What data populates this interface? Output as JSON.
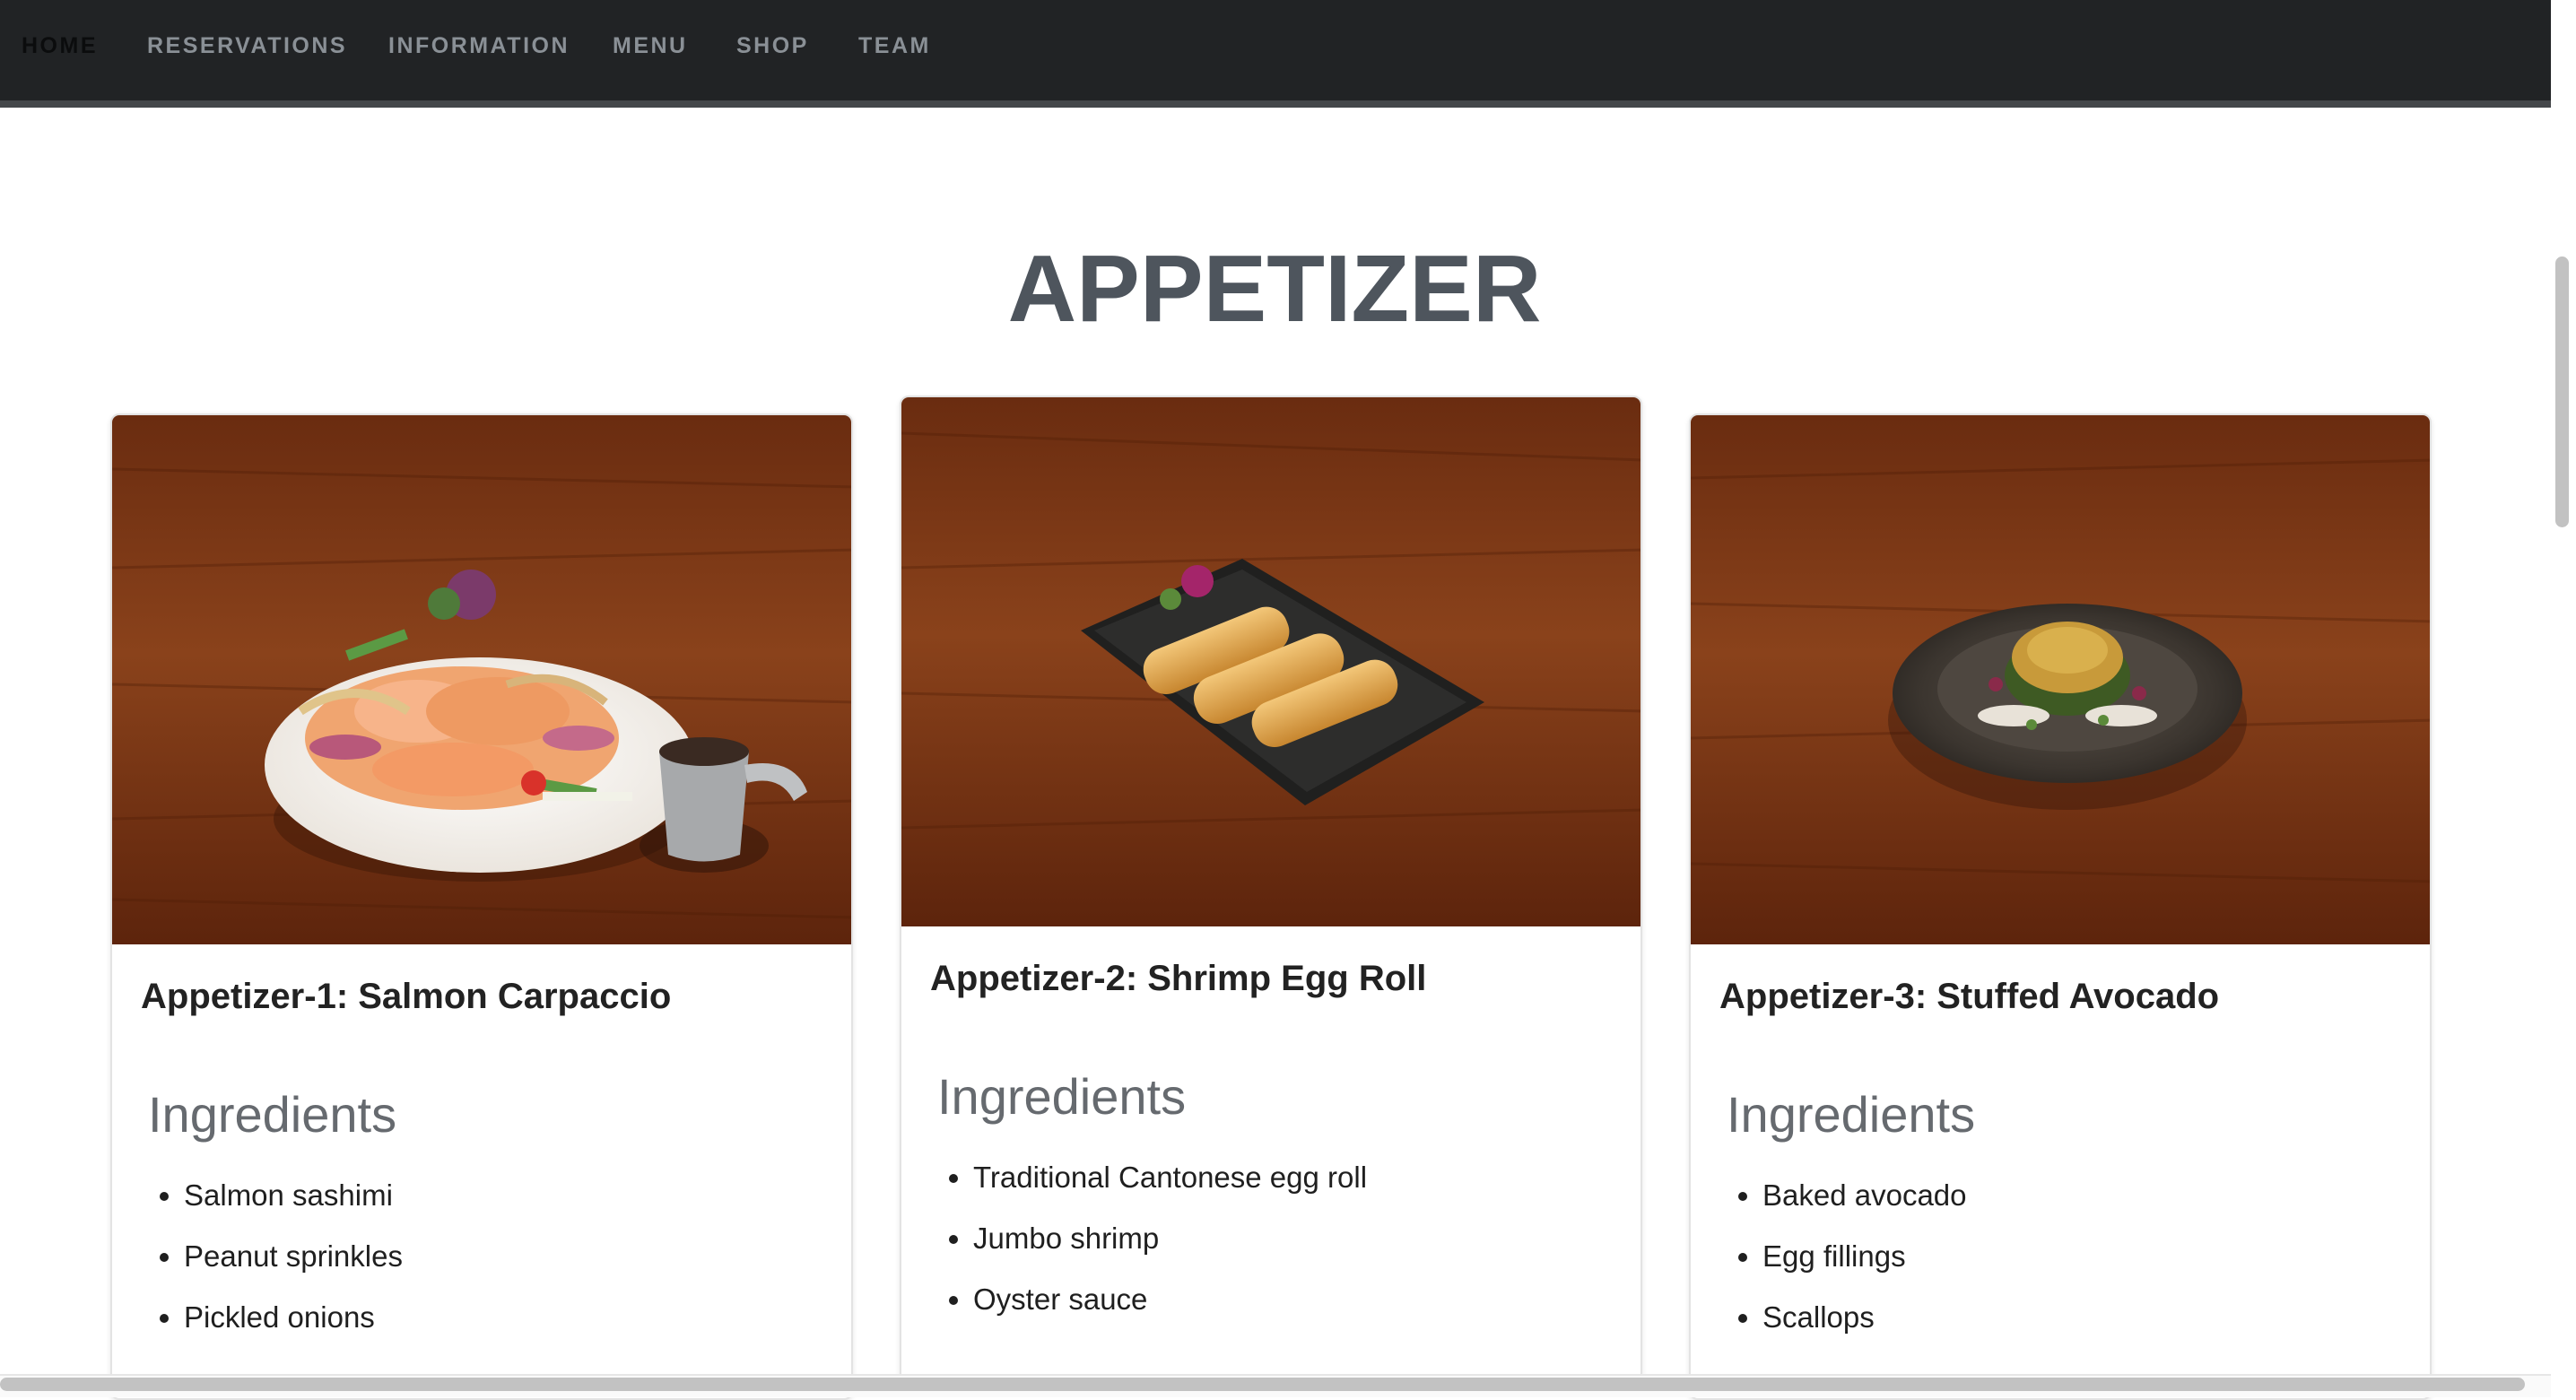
{
  "nav": {
    "items": [
      {
        "label": "HOME",
        "active": true
      },
      {
        "label": "RESERVATIONS"
      },
      {
        "label": "INFORMATION"
      },
      {
        "label": "MENU"
      },
      {
        "label": "SHOP"
      },
      {
        "label": "TEAM"
      }
    ]
  },
  "section": {
    "title": "APPETIZER"
  },
  "cards": [
    {
      "title": "Appetizer-1: Salmon Carpaccio",
      "ingredients_heading": "Ingredients",
      "ingredients": [
        "Salmon sashimi",
        "Peanut sprinkles",
        "Pickled onions"
      ]
    },
    {
      "title": "Appetizer-2: Shrimp Egg Roll",
      "ingredients_heading": "Ingredients",
      "ingredients": [
        "Traditional Cantonese egg roll",
        "Jumbo shrimp",
        "Oyster sauce"
      ]
    },
    {
      "title": "Appetizer-3: Stuffed Avocado",
      "ingredients_heading": "Ingredients",
      "ingredients": [
        "Baked avocado",
        "Egg fillings",
        "Scallops"
      ]
    }
  ],
  "colors": {
    "nav_bg": "#212325",
    "title": "#4e555d",
    "table_wood": "#7a3716"
  }
}
